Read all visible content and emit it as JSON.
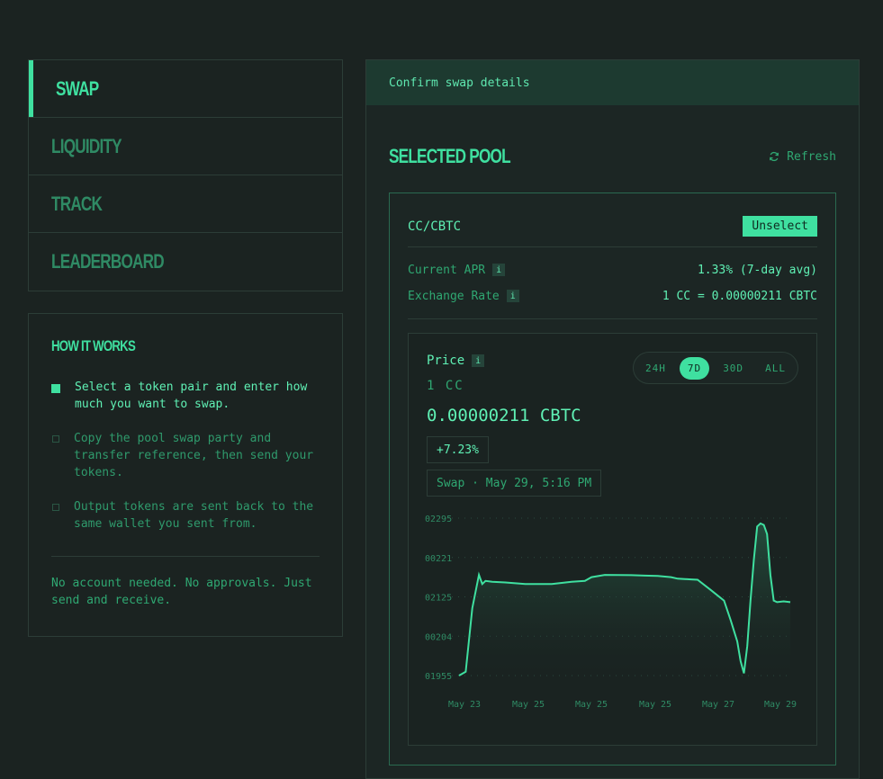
{
  "nav": {
    "items": [
      {
        "label": "SWAP",
        "active": true
      },
      {
        "label": "LIQUIDITY",
        "active": false
      },
      {
        "label": "TRACK",
        "active": false
      },
      {
        "label": "LEADERBOARD",
        "active": false
      }
    ]
  },
  "how": {
    "title": "HOW IT WORKS",
    "steps": [
      "Select a token pair and enter how much you want to swap.",
      "Copy the pool swap party and transfer reference, then send your tokens.",
      "Output tokens are sent back to the same wallet you sent from."
    ],
    "note": "No account needed. No approvals. Just send and receive."
  },
  "panel": {
    "header": "Confirm swap details",
    "section_title": "SELECTED POOL",
    "refresh_label": "Refresh",
    "pool": {
      "pair": "CC/CBTC",
      "unselect_label": "Unselect",
      "apr_label": "Current APR",
      "apr_value": "1.33% (7-day avg)",
      "rate_label": "Exchange Rate",
      "rate_value": "1 CC = 0.00000211 CBTC"
    },
    "chart_panel": {
      "price_label": "Price",
      "base": "1 CC",
      "price_value": "0.00000211 CBTC",
      "change": "+7.23%",
      "tooltip": "Swap · May 29, 5:16 PM",
      "tabs": [
        "24H",
        "7D",
        "30D",
        "ALL"
      ],
      "active_tab": "7D"
    }
  },
  "colors": {
    "accent": "#3fe0a0",
    "background": "#1b2321",
    "panel_header": "#1d3a30"
  },
  "chart_data": {
    "type": "area",
    "y_tick_labels": [
      "02295",
      "00221",
      "02125",
      "00204",
      "01955"
    ],
    "x_tick_labels": [
      "May 23",
      "May 25",
      "May 25",
      "May 25",
      "May 27",
      "May 29"
    ],
    "x": [
      0,
      2,
      4,
      6,
      7,
      8,
      10,
      14,
      20,
      28,
      34,
      38,
      40,
      44,
      52,
      56,
      60,
      64,
      66,
      70,
      72,
      76,
      80,
      82,
      84,
      85,
      86,
      87,
      88,
      89,
      90,
      91,
      92,
      93,
      94,
      95,
      96,
      98,
      100
    ],
    "values": [
      0.1955,
      0.198,
      0.24,
      0.262,
      0.256,
      0.258,
      0.2575,
      0.257,
      0.256,
      0.256,
      0.2575,
      0.258,
      0.2605,
      0.262,
      0.2618,
      0.2615,
      0.2613,
      0.2605,
      0.2595,
      0.259,
      0.2588,
      0.252,
      0.245,
      0.232,
      0.218,
      0.205,
      0.197,
      0.215,
      0.245,
      0.272,
      0.294,
      0.296,
      0.295,
      0.289,
      0.262,
      0.245,
      0.244,
      0.2445,
      0.244
    ],
    "ylim": [
      0.1955,
      0.2995
    ],
    "grid": true
  }
}
